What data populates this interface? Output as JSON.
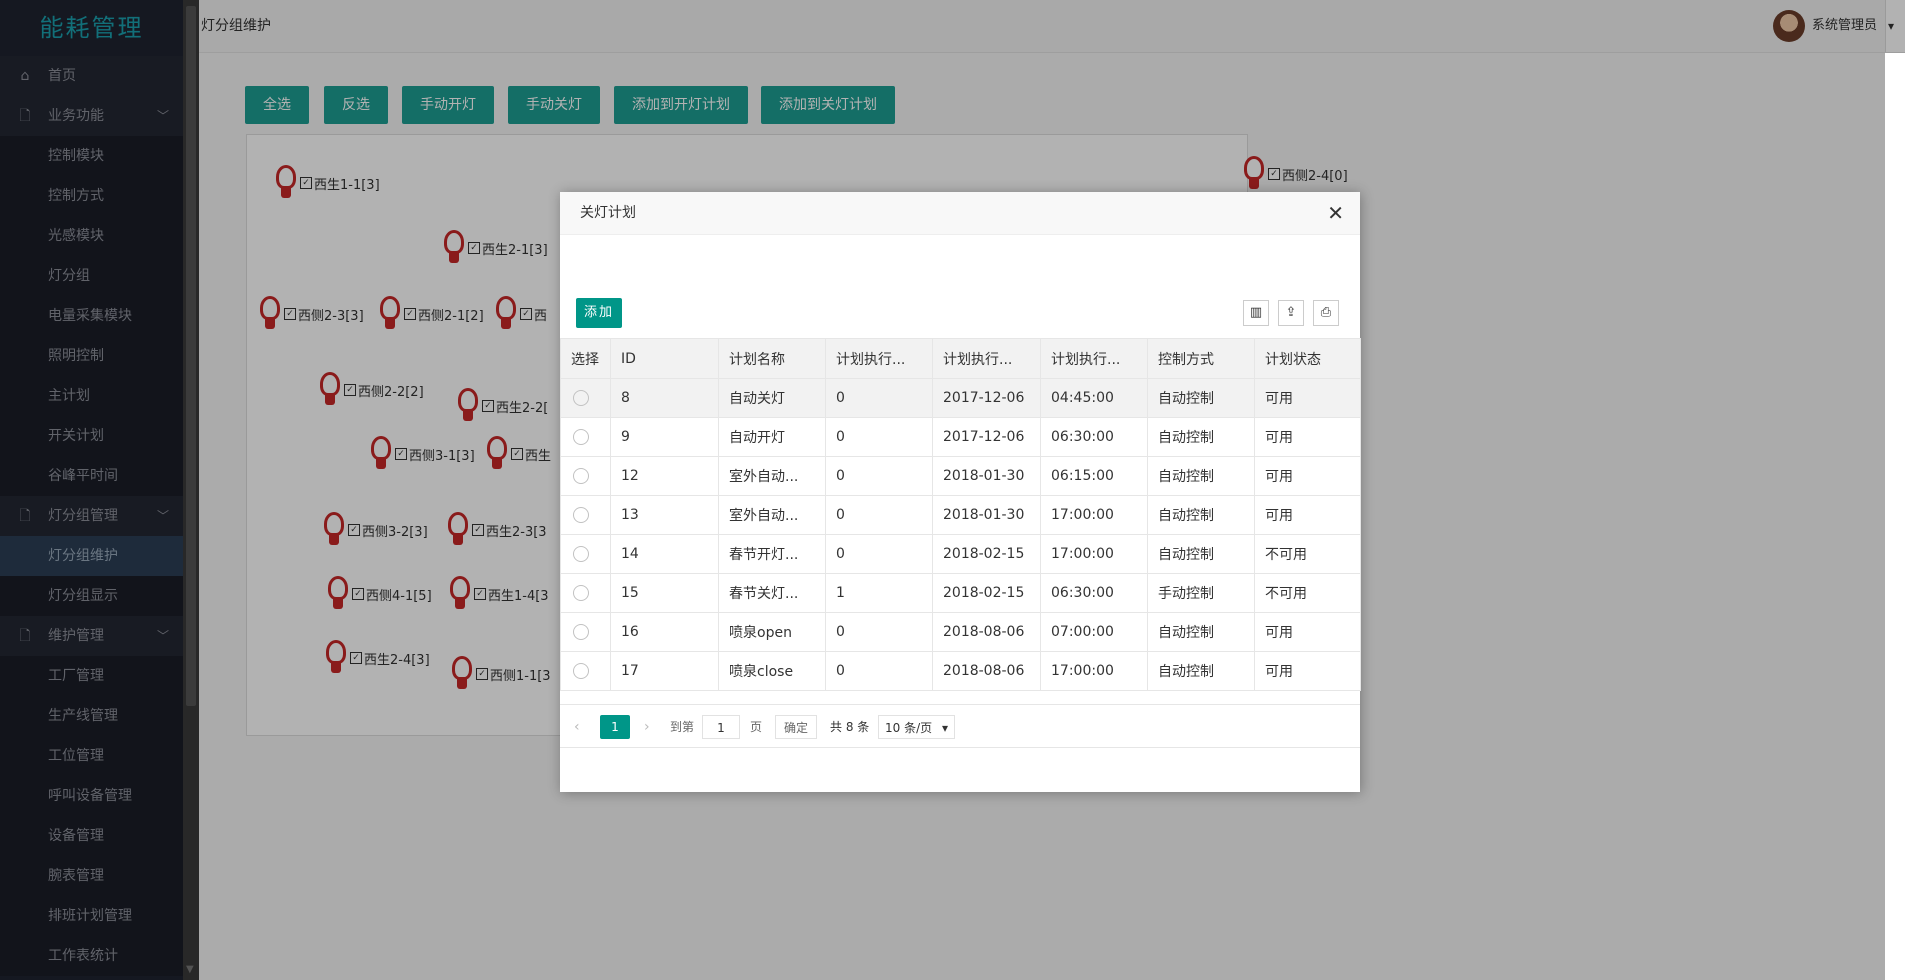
{
  "sidebar": {
    "logo": "能耗管理",
    "items": [
      {
        "label": "首页",
        "icon": "home-icon",
        "glyph": "⌂",
        "level": "top"
      },
      {
        "label": "业务功能",
        "icon": "file-icon",
        "glyph": "🗋",
        "level": "top",
        "chevron": "﹀"
      },
      {
        "label": "控制模块",
        "level": "sub"
      },
      {
        "label": "控制方式",
        "level": "sub"
      },
      {
        "label": "光感模块",
        "level": "sub"
      },
      {
        "label": "灯分组",
        "level": "sub"
      },
      {
        "label": "电量采集模块",
        "level": "sub"
      },
      {
        "label": "照明控制",
        "level": "sub"
      },
      {
        "label": "主计划",
        "level": "sub"
      },
      {
        "label": "开关计划",
        "level": "sub"
      },
      {
        "label": "谷峰平时间",
        "level": "sub"
      },
      {
        "label": "灯分组管理",
        "icon": "file-icon",
        "glyph": "🗋",
        "level": "top",
        "chevron": "﹀"
      },
      {
        "label": "灯分组维护",
        "level": "sub",
        "active": true
      },
      {
        "label": "灯分组显示",
        "level": "sub"
      },
      {
        "label": "维护管理",
        "icon": "file-icon",
        "glyph": "🗋",
        "level": "top",
        "chevron": "﹀"
      },
      {
        "label": "工厂管理",
        "level": "sub"
      },
      {
        "label": "生产线管理",
        "level": "sub"
      },
      {
        "label": "工位管理",
        "level": "sub"
      },
      {
        "label": "呼叫设备管理",
        "level": "sub"
      },
      {
        "label": "设备管理",
        "level": "sub"
      },
      {
        "label": "腕表管理",
        "level": "sub"
      },
      {
        "label": "排班计划管理",
        "level": "sub"
      },
      {
        "label": "工作表统计",
        "level": "sub"
      }
    ]
  },
  "header": {
    "breadcrumb": "灯分组维护",
    "username": "系统管理员",
    "caret": "▾"
  },
  "toolbar": {
    "select_all": "全选",
    "invert": "反选",
    "manual_on": "手动开灯",
    "manual_off": "手动关灯",
    "add_on_plan": "添加到开灯计划",
    "add_off_plan": "添加到关灯计划"
  },
  "lamps": [
    {
      "label": "西生1-1[3]"
    },
    {
      "label": "西生2-1[3]"
    },
    {
      "label": "西侧2-3[3]"
    },
    {
      "label": "西侧2-1[2]"
    },
    {
      "label": "西"
    },
    {
      "label": "西侧2-2[2]"
    },
    {
      "label": "西生2-2["
    },
    {
      "label": "西侧3-1[3]"
    },
    {
      "label": "西生"
    },
    {
      "label": "西侧3-2[3]"
    },
    {
      "label": "西生2-3[3"
    },
    {
      "label": "西侧4-1[5]"
    },
    {
      "label": "西生1-4[3"
    },
    {
      "label": "西生2-4[3]"
    },
    {
      "label": "西侧1-1[3"
    },
    {
      "label": "西侧2-4[0]"
    }
  ],
  "modal": {
    "title": "关灯计划",
    "close": "✕",
    "add_label": "添加",
    "tools": {
      "columns": "▥",
      "export": "⇪",
      "print": "⎙"
    },
    "columns": [
      "选择",
      "ID",
      "计划名称",
      "计划执行...",
      "计划执行...",
      "计划执行...",
      "控制方式",
      "计划状态"
    ],
    "rows": [
      {
        "id": "8",
        "name": "自动关灯",
        "count": "0",
        "date": "2017-12-06",
        "time": "04:45:00",
        "mode": "自动控制",
        "status": "可用"
      },
      {
        "id": "9",
        "name": "自动开灯",
        "count": "0",
        "date": "2017-12-06",
        "time": "06:30:00",
        "mode": "自动控制",
        "status": "可用"
      },
      {
        "id": "12",
        "name": "室外自动...",
        "count": "0",
        "date": "2018-01-30",
        "time": "06:15:00",
        "mode": "自动控制",
        "status": "可用"
      },
      {
        "id": "13",
        "name": "室外自动...",
        "count": "0",
        "date": "2018-01-30",
        "time": "17:00:00",
        "mode": "自动控制",
        "status": "可用"
      },
      {
        "id": "14",
        "name": "春节开灯...",
        "count": "0",
        "date": "2018-02-15",
        "time": "17:00:00",
        "mode": "自动控制",
        "status": "不可用"
      },
      {
        "id": "15",
        "name": "春节关灯...",
        "count": "1",
        "date": "2018-02-15",
        "time": "06:30:00",
        "mode": "手动控制",
        "status": "不可用"
      },
      {
        "id": "16",
        "name": "喷泉open",
        "count": "0",
        "date": "2018-08-06",
        "time": "07:00:00",
        "mode": "自动控制",
        "status": "可用"
      },
      {
        "id": "17",
        "name": "喷泉close",
        "count": "0",
        "date": "2018-08-06",
        "time": "17:00:00",
        "mode": "自动控制",
        "status": "可用"
      }
    ],
    "pager": {
      "prev": "‹",
      "current": "1",
      "next": "›",
      "goto": "到第",
      "page_input": "1",
      "page_unit": "页",
      "confirm": "确定",
      "total": "共 8 条",
      "page_size": "10 条/页",
      "page_size_caret": "▾"
    }
  },
  "colors": {
    "accent": "#009688",
    "sidebar_bg": "#1f2330",
    "lamp_red": "#c62828"
  }
}
